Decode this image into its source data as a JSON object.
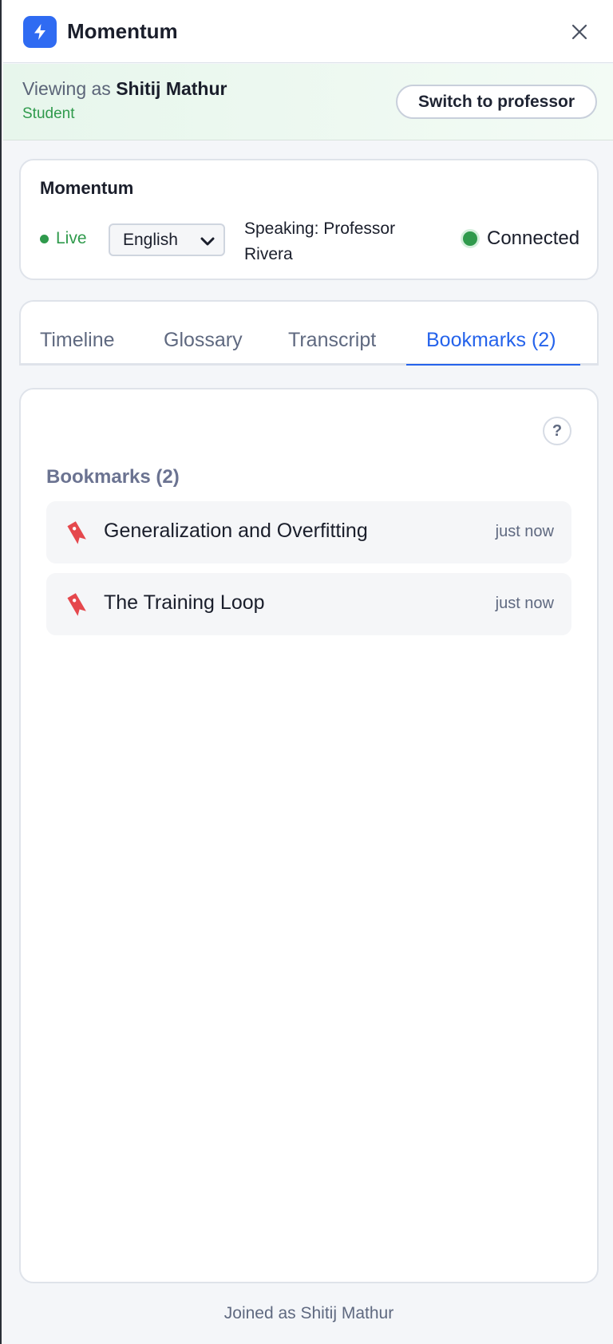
{
  "header": {
    "app_title": "Momentum",
    "logo_icon": "lightning-bolt-icon",
    "close_icon": "close-icon"
  },
  "role_banner": {
    "viewing_prefix": "Viewing as",
    "user_name": "Shitij Mathur",
    "role": "Student",
    "switch_label": "Switch to professor"
  },
  "session": {
    "title": "Momentum",
    "live_label": "Live",
    "language": "English",
    "speaking": "Speaking: Professor Rivera",
    "connection_status": "Connected"
  },
  "tabs": [
    {
      "label": "Timeline",
      "active": false
    },
    {
      "label": "Glossary",
      "active": false
    },
    {
      "label": "Transcript",
      "active": false
    },
    {
      "label": "Bookmarks (2)",
      "active": true
    }
  ],
  "bookmarks": {
    "help_label": "?",
    "section_title": "Bookmarks (2)",
    "items": [
      {
        "label": "Generalization and Overfitting",
        "time": "just now",
        "icon": "bookmark-icon"
      },
      {
        "label": "The Training Loop",
        "time": "just now",
        "icon": "bookmark-icon"
      }
    ]
  },
  "footer": {
    "text": "Joined as Shitij Mathur"
  },
  "colors": {
    "accent": "#2563eb",
    "live_green": "#2f9a4c",
    "bookmark_red": "#e5484d"
  }
}
